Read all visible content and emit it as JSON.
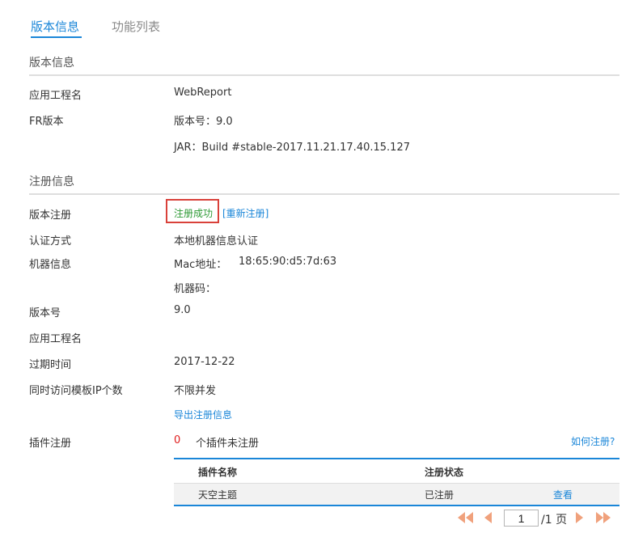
{
  "tabs": [
    {
      "label": "版本信息",
      "active": true
    },
    {
      "label": "功能列表",
      "active": false
    }
  ],
  "version_section": {
    "title": "版本信息",
    "app_name_label": "应用工程名",
    "app_name_value": "WebReport",
    "fr_version_label": "FR版本",
    "version_no": "版本号：9.0",
    "jar": "JAR：Build #stable-2017.11.21.17.40.15.127"
  },
  "registration_section": {
    "title": "注册信息",
    "reg_label": "版本注册",
    "reg_status": "注册成功",
    "rereg_link": "[重新注册]",
    "auth_label": "认证方式",
    "auth_value": "本地机器信息认证",
    "machine_label": "机器信息",
    "mac_label": "Mac地址：",
    "mac_value": "18:65:90:d5:7d:63",
    "machine_code_label": "机器码：",
    "version_label": "版本号",
    "version_value": "9.0",
    "app_name_label": "应用工程名",
    "expire_label": "过期时间",
    "expire_value": "2017-12-22",
    "concurrent_label": "同时访问模板IP个数",
    "concurrent_value": "不限并发",
    "export_link": "导出注册信息"
  },
  "plugin_section": {
    "label": "插件注册",
    "unregistered_count": "0",
    "unregistered_text": "个插件未注册",
    "howto_link": "如何注册?",
    "columns": [
      "插件名称",
      "注册状态"
    ],
    "rows": [
      {
        "name": "天空主题",
        "status": "已注册",
        "action": "查看"
      }
    ]
  },
  "pager": {
    "current_page": "1",
    "total": "/1 页"
  },
  "colors": {
    "accent": "#1a86d8",
    "success": "#2e9a36",
    "error": "#e02020",
    "highlight_box": "#d9413a",
    "pager_arrow": "#f0a17c"
  },
  "icons": {
    "first": "double-left-arrow-icon",
    "prev": "left-arrow-icon",
    "next": "right-arrow-icon",
    "last": "double-right-arrow-icon"
  }
}
